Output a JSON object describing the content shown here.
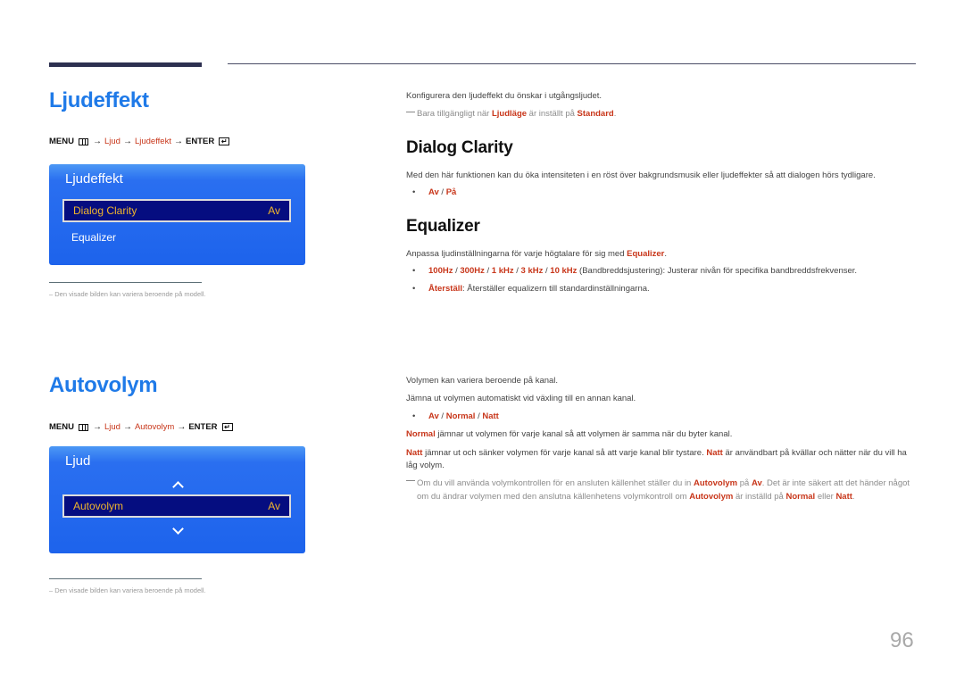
{
  "page_number": "96",
  "colors": {
    "title_blue": "#1f7ae8",
    "highlight_red": "#c8361a",
    "panel_blue": "#1d63ec",
    "selected_bg": "#050d80",
    "selected_text": "#f0b52c"
  },
  "sections": {
    "ljudeffekt": {
      "title": "Ljudeffekt",
      "menu_path": {
        "menu": "MENU",
        "step1": "Ljud",
        "step2": "Ljudeffekt",
        "enter": "ENTER",
        "arrow": "→"
      },
      "panel": {
        "title": "Ljudeffekt",
        "items": [
          {
            "label": "Dialog Clarity",
            "value": "Av",
            "selected": true
          },
          {
            "label": "Equalizer",
            "value": "",
            "selected": false
          }
        ]
      },
      "footnote": "Den visade bilden kan variera beroende på modell.",
      "intro": "Konfigurera den ljudeffekt du önskar i utgångsljudet.",
      "note": {
        "prefix": "Bara tillgängligt när ",
        "k1": "Ljudläge",
        "mid": " är inställt på ",
        "k2": "Standard",
        "suffix": "."
      },
      "dialog_clarity": {
        "heading": "Dialog Clarity",
        "text": "Med den här funktionen kan du öka intensiteten i en röst över bakgrundsmusik eller ljudeffekter så att dialogen hörs tydligare.",
        "options": {
          "a": "Av",
          "sep": " / ",
          "b": "På"
        }
      },
      "equalizer": {
        "heading": "Equalizer",
        "text_prefix": "Anpassa ljudinställningarna för varje högtalare för sig med ",
        "text_keyword": "Equalizer",
        "text_suffix": ".",
        "bullet1": {
          "f1": "100Hz",
          "f2": "300Hz",
          "f3": "1 kHz",
          "f4": "3 kHz",
          "f5": "10 kHz",
          "sep": " / ",
          "desc": " (Bandbreddsjustering): Justerar nivån för specifika bandbreddsfrekvenser."
        },
        "bullet2": {
          "keyword": "Återställ",
          "desc": ": Återställer equalizern till standardinställningarna."
        }
      }
    },
    "autovolym": {
      "title": "Autovolym",
      "menu_path": {
        "menu": "MENU",
        "step1": "Ljud",
        "step2": "Autovolym",
        "enter": "ENTER",
        "arrow": "→"
      },
      "panel": {
        "title": "Ljud",
        "items": [
          {
            "label": "Autovolym",
            "value": "Av",
            "selected": true
          }
        ]
      },
      "footnote": "Den visade bilden kan variera beroende på modell.",
      "line1": "Volymen kan variera beroende på kanal.",
      "line2": "Jämna ut volymen automatiskt vid växling till en annan kanal.",
      "options": {
        "a": "Av",
        "b": "Normal",
        "c": "Natt",
        "sep": " / "
      },
      "normal_desc": {
        "keyword": "Normal",
        "text": " jämnar ut volymen för varje kanal så att volymen är samma när du byter kanal."
      },
      "natt_desc": {
        "keyword": "Natt",
        "text1": " jämnar ut och sänker volymen för varje kanal så att varje kanal blir tystare. ",
        "keyword2": "Natt",
        "text2": " är användbart på kvällar och nätter när du vill ha låg volym."
      },
      "note": {
        "t1": "Om du vill använda volymkontrollen för en ansluten källenhet ställer du in ",
        "k1": "Autovolym",
        "t2": " på ",
        "k2": "Av",
        "t3": ". Det är inte säkert att det händer något om du ändrar volymen med den anslutna källenhetens volymkontroll om ",
        "k3": "Autovolym",
        "t4": " är inställd på ",
        "k4": "Normal",
        "t5": " eller ",
        "k5": "Natt",
        "t6": "."
      }
    }
  }
}
